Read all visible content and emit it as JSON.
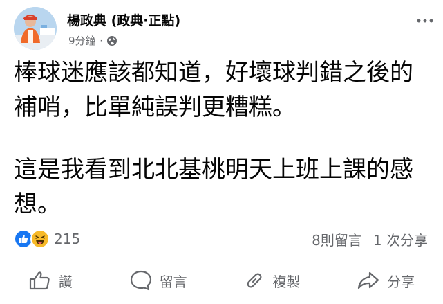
{
  "post": {
    "author": "楊政典 (政典·正點)",
    "time": "9分鐘",
    "separator": "·",
    "privacy_icon": "globe-icon",
    "menu_icon": "more-horizontal-icon",
    "paragraphs": [
      "棒球迷應該都知道，好壞球判錯之後的補哨，比單純誤判更糟糕。",
      "這是我看到北北基桃明天上班上課的感想。"
    ]
  },
  "reactions": {
    "icons": [
      "like-icon",
      "haha-icon"
    ],
    "count": "215",
    "comments": "8則留言",
    "shares": "1 次分享"
  },
  "actions": {
    "like": "讚",
    "comment": "留言",
    "copy": "複製",
    "share": "分享"
  },
  "colors": {
    "text": "#050505",
    "secondary": "#65676b",
    "like_blue": "#1877f2",
    "haha_yellow": "#f7b928",
    "divider": "#dadde1"
  }
}
